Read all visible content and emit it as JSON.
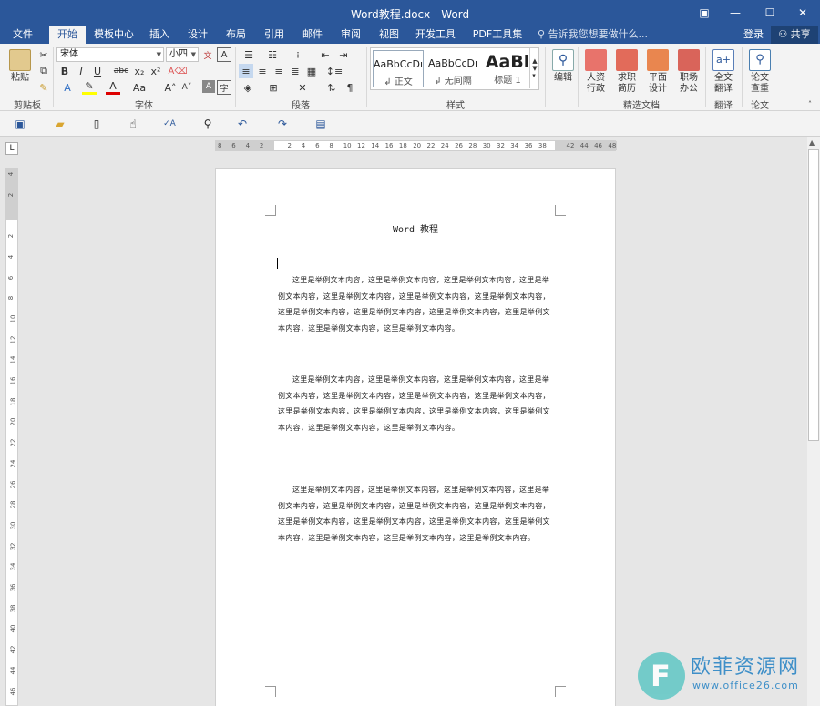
{
  "window": {
    "title": "Word教程.docx - Word",
    "minimize": "—",
    "restore": "☐",
    "close": "✕",
    "ribbon_toggle": "▣"
  },
  "tabs": [
    "文件",
    "开始",
    "模板中心",
    "插入",
    "设计",
    "布局",
    "引用",
    "邮件",
    "审阅",
    "视图",
    "开发工具",
    "PDF工具集"
  ],
  "active_tab": "开始",
  "tell_me": "告诉我您想要做什么...",
  "account": {
    "login": "登录",
    "share": "共享"
  },
  "ribbon": {
    "clipboard": {
      "label": "剪贴板",
      "paste": "粘贴"
    },
    "font": {
      "label": "字体",
      "font_name": "宋体",
      "font_size": "小四",
      "bold": "B",
      "italic": "I",
      "underline": "U",
      "strike": "abc",
      "sub": "x₂",
      "sup": "x²",
      "clear": "A",
      "grow": "A˄",
      "shrink": "A˅",
      "aa": "Aa",
      "wen": "文"
    },
    "paragraph": {
      "label": "段落"
    },
    "styles": {
      "label": "样式",
      "items": [
        {
          "preview": "AaBbCcDı",
          "name": "↲ 正文"
        },
        {
          "preview": "AaBbCcDı",
          "name": "↲ 无间隔"
        },
        {
          "preview": "AaBl",
          "name": "标题 1"
        }
      ]
    },
    "editing": {
      "label": "编辑"
    },
    "docs": {
      "label": "精选文档",
      "items": [
        "人资\n行政",
        "求职\n简历",
        "平面\n设计",
        "职场\n办公"
      ]
    },
    "translate": {
      "label": "翻译",
      "item": "全文\n翻译"
    },
    "paper": {
      "label": "论文",
      "item": "论文\n查重"
    }
  },
  "ruler": {
    "h": [
      "8",
      "6",
      "4",
      "2",
      "",
      "2",
      "4",
      "6",
      "8",
      "10",
      "12",
      "14",
      "16",
      "18",
      "20",
      "22",
      "24",
      "26",
      "28",
      "30",
      "32",
      "34",
      "36",
      "38",
      "",
      "42",
      "44",
      "46",
      "48"
    ],
    "v": [
      "4",
      "2",
      "",
      "2",
      "4",
      "6",
      "8",
      "10",
      "12",
      "14",
      "16",
      "18",
      "20",
      "22",
      "24",
      "26",
      "28",
      "30",
      "32",
      "34",
      "36",
      "38",
      "40",
      "42",
      "44",
      "46"
    ],
    "tab_stop": "L"
  },
  "document": {
    "title": "Word 教程",
    "paragraphs": [
      "这里是举例文本内容，这里是举例文本内容，这里是举例文本内容，这里是举例文本内容，这里是举例文本内容，这里是举例文本内容，这里是举例文本内容，这里是举例文本内容，这里是举例文本内容，这里是举例文本内容，这里是举例文本内容，这里是举例文本内容，这里是举例文本内容。",
      "这里是举例文本内容，这里是举例文本内容，这里是举例文本内容，这里是举例文本内容，这里是举例文本内容，这里是举例文本内容，这里是举例文本内容，这里是举例文本内容，这里是举例文本内容，这里是举例文本内容，这里是举例文本内容，这里是举例文本内容，这里是举例文本内容。",
      "这里是举例文本内容，这里是举例文本内容，这里是举例文本内容，这里是举例文本内容，这里是举例文本内容，这里是举例文本内容，这里是举例文本内容，这里是举例文本内容，这里是举例文本内容，这里是举例文本内容，这里是举例文本内容，这里是举例文本内容，这里是举例文本内容，这里是举例文本内容。"
    ]
  },
  "watermark": {
    "logo": "F",
    "name": "欧菲资源网",
    "url": "www.office26.com"
  },
  "colors": {
    "accent": "#2b579a",
    "ribbon": "#f3f3f3",
    "canvas": "#e6e6e6"
  }
}
